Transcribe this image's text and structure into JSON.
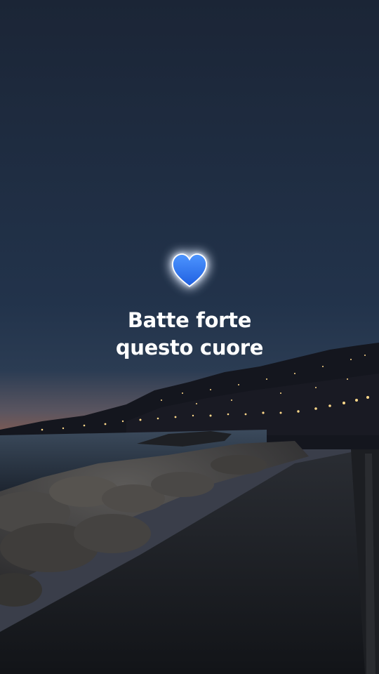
{
  "story": {
    "caption_lines": [
      "Batte forte",
      "questo cuore"
    ],
    "sticker": {
      "icon": "blue-heart-icon",
      "color": "#2f7dff"
    }
  },
  "colors": {
    "sky_top": "#1b2536",
    "sky_mid": "#24344c",
    "horizon": "#7a5a55",
    "sea": "#2c3b4d",
    "city_lights": "#ffd98a"
  }
}
